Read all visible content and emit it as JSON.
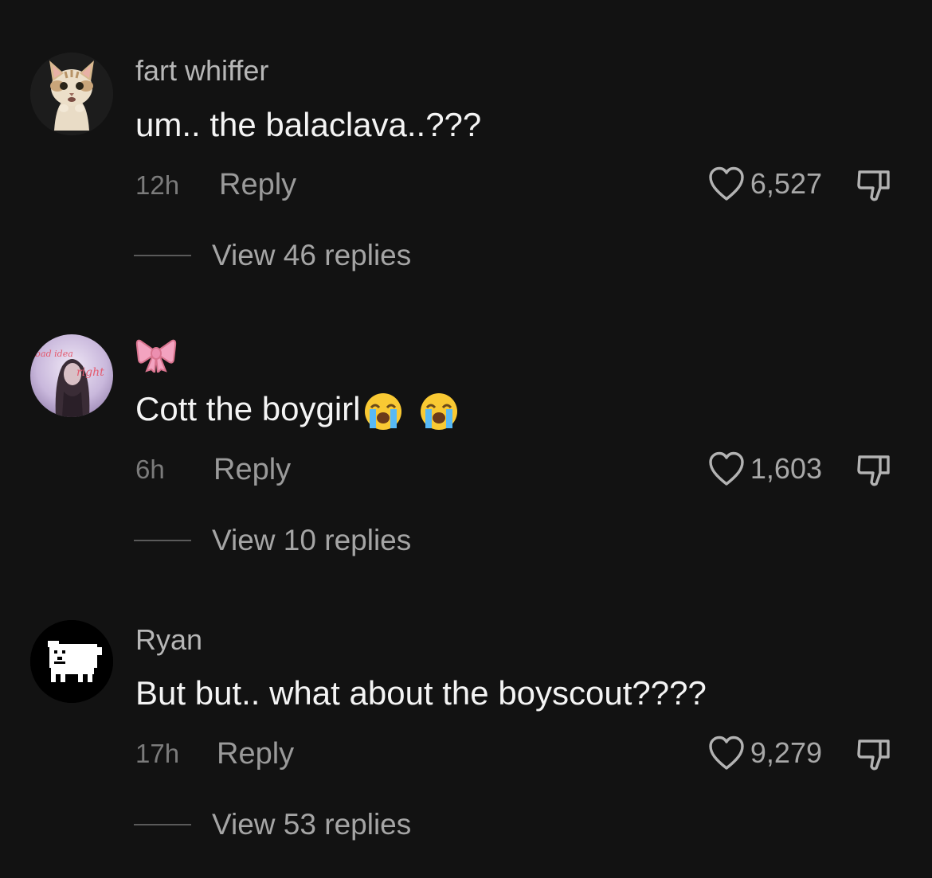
{
  "comments": [
    {
      "username": "fart whiffer",
      "text": "um.. the balaclava..???",
      "time": "12h",
      "reply_label": "Reply",
      "likes": "6,527",
      "view_replies": "View 46 replies",
      "avatar": "cat-avatar"
    },
    {
      "username": "🎀",
      "text": "Cott the boygirl",
      "text_emojis": [
        "loudly-crying-face",
        "loudly-crying-face"
      ],
      "time": "6h",
      "reply_label": "Reply",
      "likes": "1,603",
      "view_replies": "View 10 replies",
      "avatar": "girl-photo-avatar",
      "avatar_text": "bad idea right"
    },
    {
      "username": "Ryan",
      "text": "But but.. what about the boyscout????",
      "time": "17h",
      "reply_label": "Reply",
      "likes": "9,279",
      "view_replies": "View 53 replies",
      "avatar": "pixel-dog-avatar"
    }
  ],
  "icons": {
    "like": "heart-outline-icon",
    "dislike": "thumbs-down-outline-icon"
  },
  "colors": {
    "background": "#121212",
    "username": "#b7b7b7",
    "text": "#f4f4f4",
    "muted": "#7b7b7b",
    "bow_pink": "#f3a3c0"
  }
}
